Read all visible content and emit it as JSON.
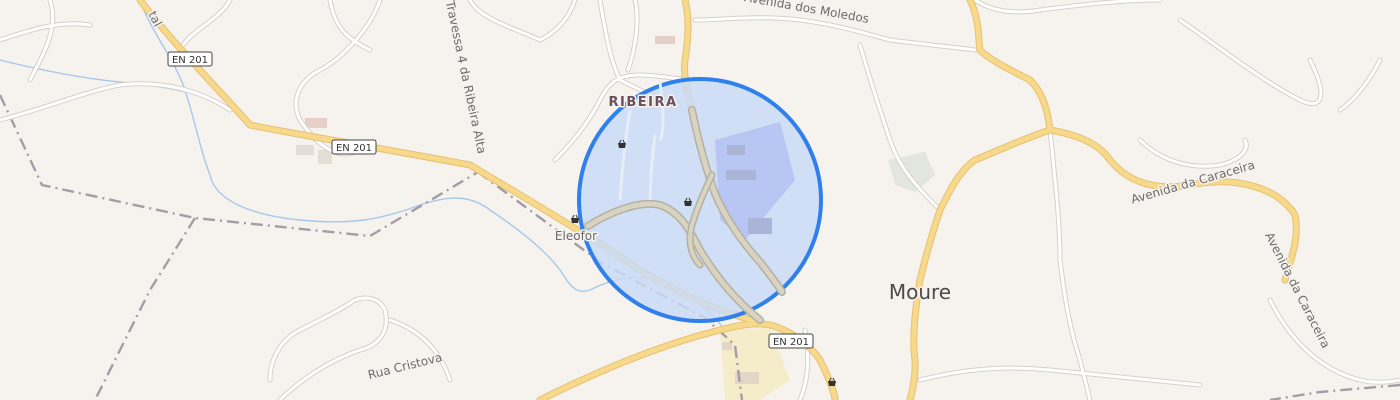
{
  "map": {
    "town_label": "Moure",
    "locality_label": "RIBEIRA",
    "poi_label": "Eleofor",
    "road_shields": [
      {
        "ref": "EN 201"
      },
      {
        "ref": "EN 201"
      },
      {
        "ref": "EN 201"
      }
    ],
    "street_labels": {
      "avenida_dos_moledos": "Avenida dos Moledos",
      "travessa_ribeira_alta": "Travessa 4 da Ribeira Alta",
      "avenida_caraceira_1": "Avenida da Caraceira",
      "avenida_caraceira_2": "Avenida da Caraceira",
      "rua_cristova": "Rua Cristova",
      "partial_tal": "tal"
    },
    "colors": {
      "background": "#f6f3ef",
      "major_road": "#f7d98c",
      "major_road_casing": "#e8c070",
      "minor_road": "#ffffff",
      "minor_road_casing": "#d9d5cf",
      "water": "#a8c8ea",
      "boundary": "#9b96a0",
      "accuracy_fill": "#c9dbf6",
      "accuracy_stroke": "#2f80ed"
    },
    "icons": [
      "shopping-basket-icon",
      "shopping-basket-icon",
      "shopping-basket-icon",
      "shopping-basket-icon"
    ]
  }
}
